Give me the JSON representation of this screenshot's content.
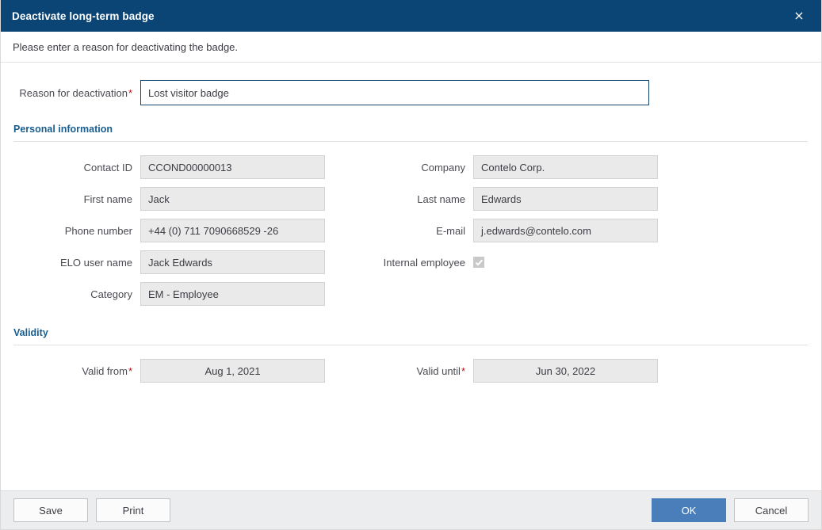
{
  "titlebar": {
    "title": "Deactivate long-term badge",
    "close_label": "×"
  },
  "instruction": "Please enter a reason for deactivating the badge.",
  "reason": {
    "label": "Reason for deactivation",
    "required_marker": "*",
    "value": "Lost visitor badge",
    "placeholder": ""
  },
  "sections": [
    {
      "title": "Personal information",
      "rows": [
        {
          "left": {
            "label": "Contact ID",
            "value": "CCOND00000013"
          },
          "right": {
            "label": "Company",
            "value": "Contelo Corp."
          }
        },
        {
          "left": {
            "label": "First name",
            "value": "Jack"
          },
          "right": {
            "label": "Last name",
            "value": "Edwards"
          }
        },
        {
          "left": {
            "label": "Phone number",
            "value": "+44 (0) 711 7090668529 -26"
          },
          "right": {
            "label": "E-mail",
            "value": "j.edwards@contelo.com"
          }
        },
        {
          "left": {
            "label": "ELO user name",
            "value": "Jack Edwards"
          },
          "right": {
            "label": "Internal employee",
            "type": "checkbox",
            "checked": true
          }
        },
        {
          "left": {
            "label": "Category",
            "value": "EM - Employee"
          },
          "right": {
            "label": "",
            "value": ""
          }
        }
      ]
    },
    {
      "title": "Validity",
      "rows": [
        {
          "left": {
            "label": "Valid from",
            "required_marker": "*",
            "value": "Aug 1, 2021"
          },
          "right": {
            "label": "Valid until",
            "required_marker": "*",
            "value": "Jun 30, 2022"
          }
        }
      ]
    }
  ],
  "footer": {
    "save_label": "Save",
    "print_label": "Print",
    "ok_label": "OK",
    "cancel_label": "Cancel"
  },
  "colors": {
    "titlebar_bg": "#0a4576",
    "section_title": "#1a5d8f",
    "required_asterisk": "#b5121b",
    "primary_button": "#4a7ebb",
    "field_bg": "#eaeaea",
    "footer_bg": "#ebedee",
    "focus_border": "#13466f"
  }
}
